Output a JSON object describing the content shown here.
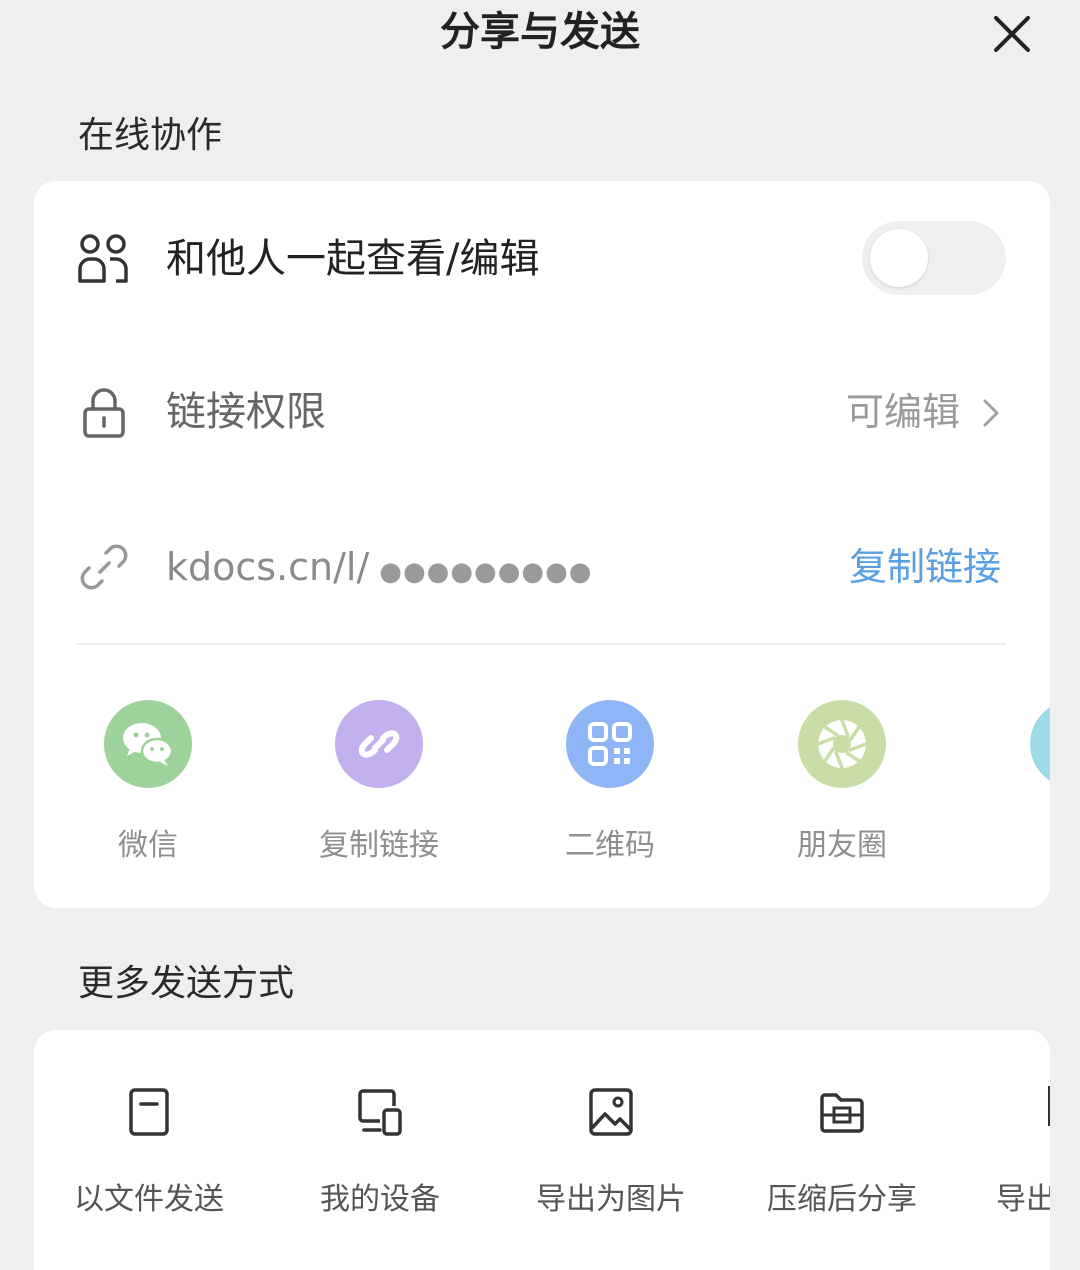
{
  "header": {
    "title": "分享与发送"
  },
  "online": {
    "section_label": "在线协作",
    "collab_label": "和他人一起查看/编辑",
    "collab_enabled": false,
    "permission_label": "链接权限",
    "permission_value": "可编辑",
    "link_prefix": "kdocs.cn/l/",
    "link_masked": "●●●●●●●●●",
    "copy_link_label": "复制链接"
  },
  "share_targets": [
    {
      "label": "微信",
      "icon": "wechat-icon",
      "color": "#9dd39a"
    },
    {
      "label": "复制链接",
      "icon": "link-icon",
      "color": "#c2b1ee"
    },
    {
      "label": "二维码",
      "icon": "qr-code-icon",
      "color": "#8fb5f6"
    },
    {
      "label": "朋友圈",
      "icon": "moments-icon",
      "color": "#c9dea6"
    }
  ],
  "more": {
    "section_label": "更多发送方式",
    "items": [
      {
        "label": "以文件发送",
        "icon": "file-icon"
      },
      {
        "label": "我的设备",
        "icon": "devices-icon"
      },
      {
        "label": "导出为图片",
        "icon": "image-icon"
      },
      {
        "label": "压缩后分享",
        "icon": "archive-icon"
      },
      {
        "label": "导出",
        "icon": "export-icon"
      }
    ]
  },
  "colors": {
    "accent_link": "#5b9fe3",
    "muted_text": "#999999"
  }
}
